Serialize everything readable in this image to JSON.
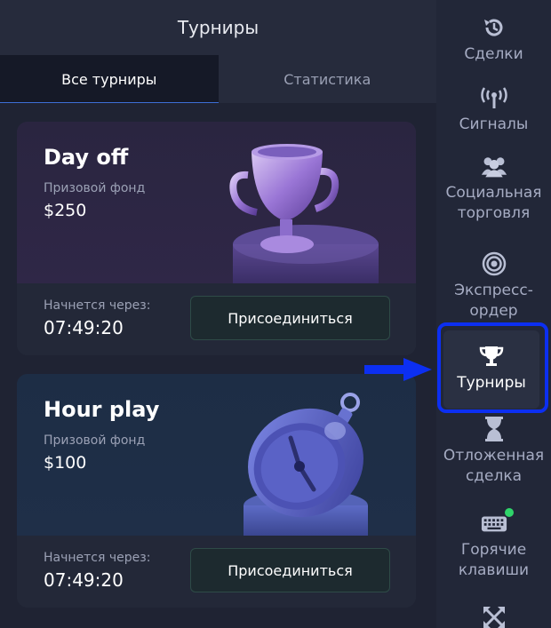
{
  "panel": {
    "title": "Турниры",
    "tabs": [
      {
        "label": "Все турниры",
        "active": true
      },
      {
        "label": "Статистика",
        "active": false
      }
    ]
  },
  "tournaments": [
    {
      "title": "Day off",
      "fund_label": "Призовой фонд",
      "fund": "$250",
      "starts_label": "Начнется через:",
      "starts_time": "07:49:20",
      "join_label": "Присоединиться",
      "art": "trophy-illustration"
    },
    {
      "title": "Hour play",
      "fund_label": "Призовой фонд",
      "fund": "$100",
      "starts_label": "Начнется через:",
      "starts_time": "07:49:20",
      "join_label": "Присоединиться",
      "art": "stopwatch-illustration"
    }
  ],
  "sidebar": {
    "items": [
      {
        "label": "Сделки",
        "icon": "history-icon"
      },
      {
        "label": "Сигналы",
        "icon": "signal-icon"
      },
      {
        "label": "Социальная торговля",
        "icon": "users-icon"
      },
      {
        "label": "Экспресс-ордер",
        "icon": "target-icon"
      },
      {
        "label": "Турниры",
        "icon": "trophy-icon",
        "active": true
      },
      {
        "label": "Отложенная сделка",
        "icon": "hourglass-icon"
      },
      {
        "label": "Горячие клавиши",
        "icon": "keyboard-icon",
        "status_dot": true
      },
      {
        "label": "",
        "icon": "expand-icon"
      }
    ]
  },
  "colors": {
    "highlight": "#0c2ff2",
    "accent_tab": "#3d6fd6",
    "status_dot": "#2fd46a"
  }
}
